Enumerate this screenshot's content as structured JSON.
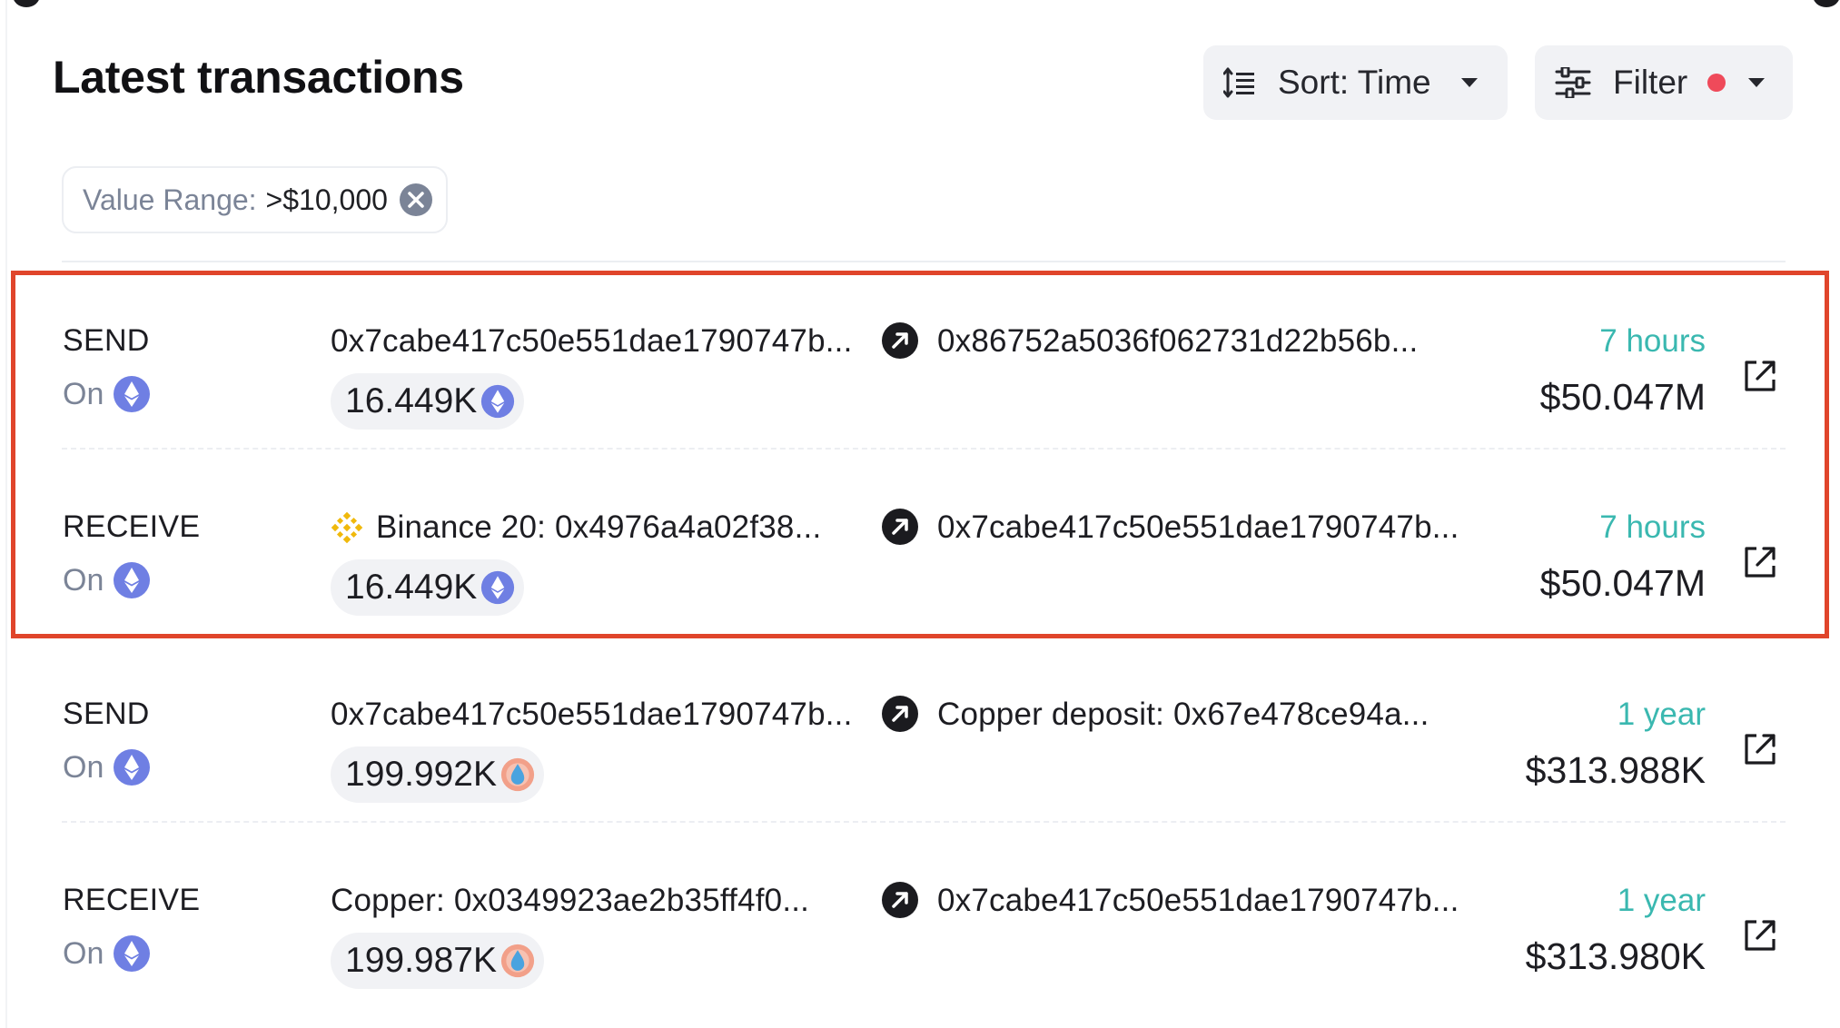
{
  "header": {
    "title": "Latest transactions",
    "sort_label": "Sort: Time",
    "filter_label": "Filter"
  },
  "active_filter": {
    "key": "Value Range:",
    "value": ">$10,000"
  },
  "colors": {
    "accent_teal": "#3ab8b0",
    "highlight_red": "#e0452b",
    "filter_dot": "#ef4a5a",
    "eth_purple": "#6f7fe3"
  },
  "transactions": [
    {
      "type": "SEND",
      "chain_label": "On",
      "chain_icon": "ethereum-icon",
      "from": "0x7cabe417c50e551dae1790747b...",
      "to": "0x86752a5036f062731d22b56b...",
      "amount": "16.449K",
      "token_icon": "ethereum-icon",
      "time": "7 hours",
      "usd": "$50.047M"
    },
    {
      "type": "RECEIVE",
      "chain_label": "On",
      "chain_icon": "ethereum-icon",
      "from_icon": "binance-icon",
      "from": "Binance 20: 0x4976a4a02f38...",
      "to": "0x7cabe417c50e551dae1790747b...",
      "amount": "16.449K",
      "token_icon": "ethereum-icon",
      "time": "7 hours",
      "usd": "$50.047M"
    },
    {
      "type": "SEND",
      "chain_label": "On",
      "chain_icon": "ethereum-icon",
      "from": "0x7cabe417c50e551dae1790747b...",
      "to": "Copper deposit: 0x67e478ce94a...",
      "amount": "199.992K",
      "token_icon": "staked-token-icon",
      "time": "1 year",
      "usd": "$313.988K"
    },
    {
      "type": "RECEIVE",
      "chain_label": "On",
      "chain_icon": "ethereum-icon",
      "from": "Copper: 0x0349923ae2b35ff4f0...",
      "to": "0x7cabe417c50e551dae1790747b...",
      "amount": "199.987K",
      "token_icon": "staked-token-icon",
      "time": "1 year",
      "usd": "$313.980K"
    }
  ]
}
